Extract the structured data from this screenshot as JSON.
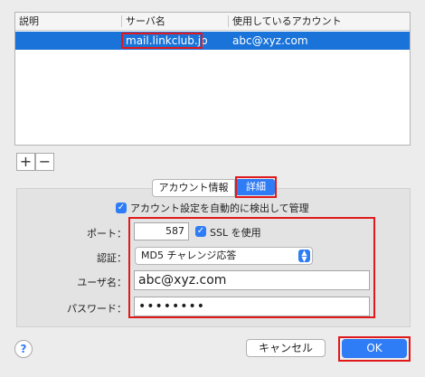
{
  "table": {
    "headers": [
      "説明",
      "サーバ名",
      "使用しているアカウント"
    ],
    "rows": [
      {
        "description": "",
        "server": "mail.linkclub.jp",
        "account": "abc@xyz.com",
        "selected": true
      }
    ]
  },
  "list_controls": {
    "add": "+",
    "remove": "−"
  },
  "tabs": [
    {
      "label": "アカウント情報",
      "active": false
    },
    {
      "label": "詳細",
      "active": true
    }
  ],
  "auto_manage": {
    "label": "アカウント設定を自動的に検出して管理",
    "checked": true
  },
  "port": {
    "label": "ポート：",
    "value": "587"
  },
  "ssl": {
    "label": "SSL を使用",
    "checked": true
  },
  "auth": {
    "label": "認証：",
    "value": "MD5 チャレンジ応答"
  },
  "username": {
    "label": "ユーザ名：",
    "value": "abc@xyz.com"
  },
  "password": {
    "label": "パスワード：",
    "masked": "••••••••"
  },
  "buttons": {
    "help": "?",
    "cancel": "キャンセル",
    "ok": "OK"
  },
  "colors": {
    "accent": "#2e7cf6",
    "selection": "#1a73d9",
    "highlight": "#e0191c"
  }
}
